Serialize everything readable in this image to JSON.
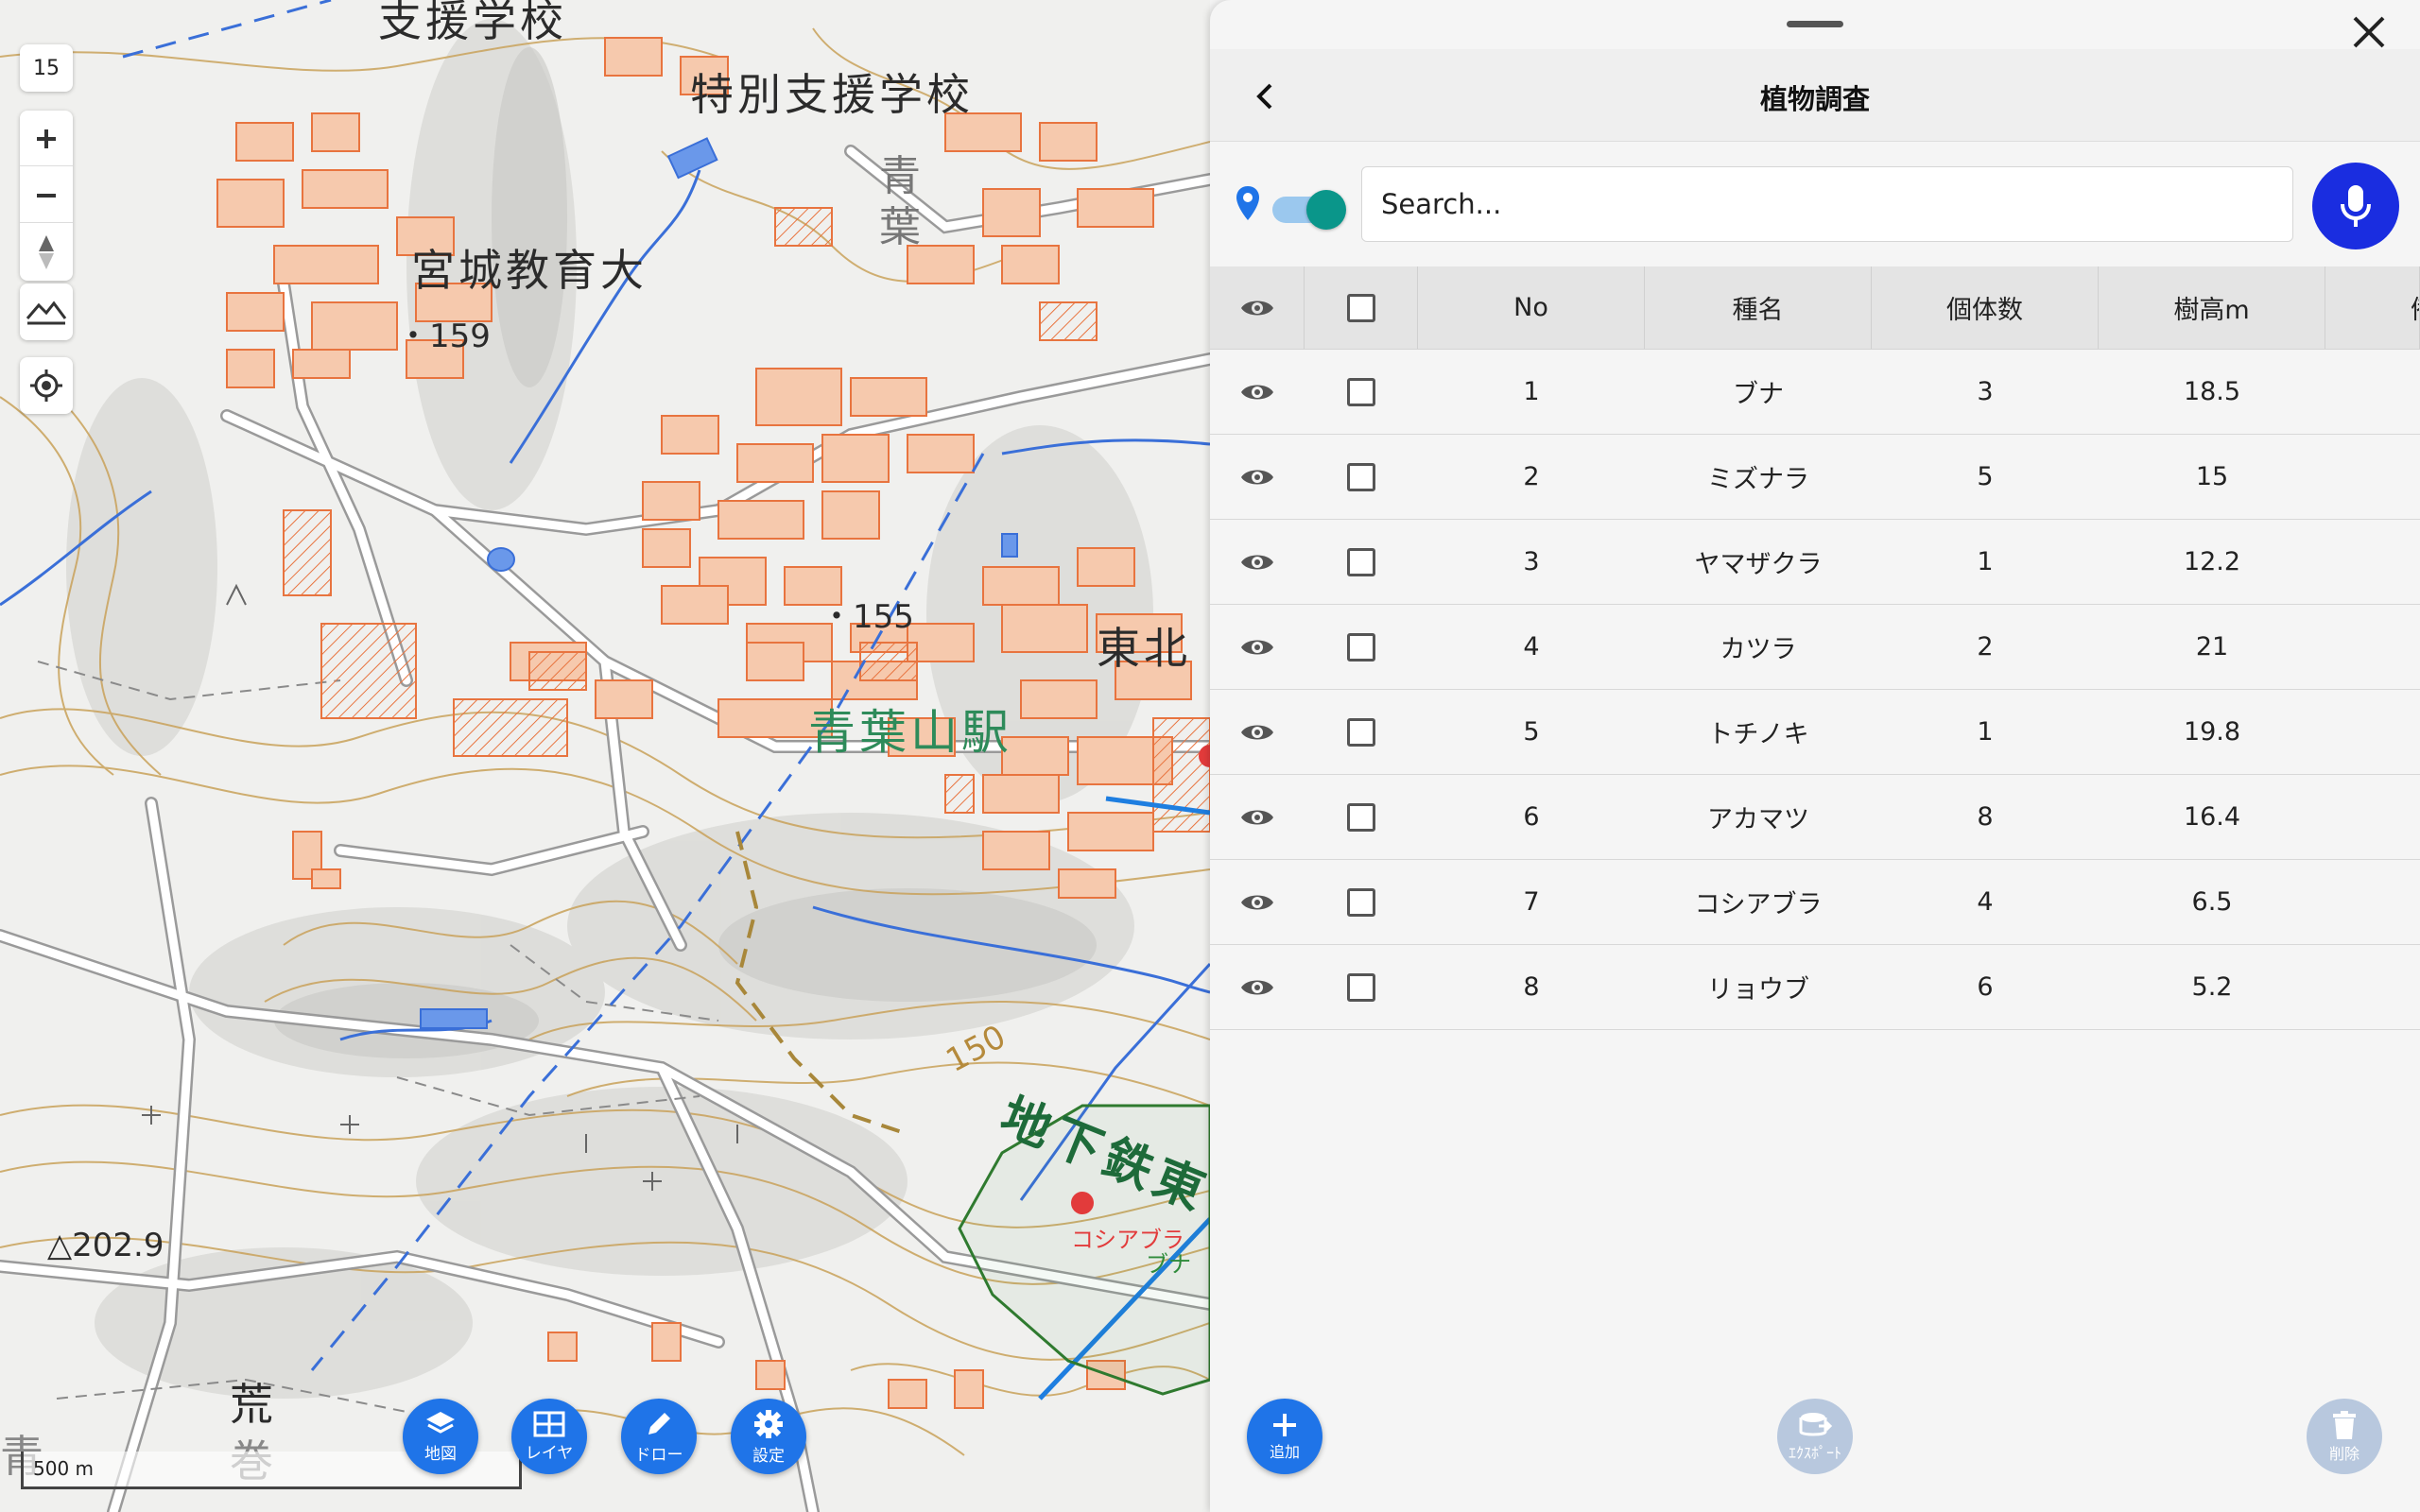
{
  "map": {
    "zoom_level": "15",
    "scale_label": "500 m",
    "labels": {
      "school_top": "支援学校",
      "special_school": "特別支援学校",
      "university": "宮城教育大",
      "elev_159": "・159",
      "aoba_vertical": "青\n葉",
      "elev_155": "・155",
      "tohoku": "東北",
      "station": "青葉山駅",
      "contour_150": "150",
      "subway": "地下鉄東",
      "triangulation": "△202.9",
      "ara": "荒",
      "maki": "巻",
      "ao": "青",
      "feature_koshiabura": "コシアブラ",
      "feature_buna": "ブナ"
    },
    "buttons": {
      "basemap": "地図",
      "layer": "レイヤ",
      "draw": "ドロー",
      "settings": "設定"
    },
    "colors": {
      "building": "#f1a27a",
      "contour": "#c9a25a",
      "water": "#3a6fd8",
      "road": "#ffffff",
      "polygon": "#2f7a2f",
      "point": "#e23b3b"
    }
  },
  "panel": {
    "title": "植物調査",
    "search": {
      "placeholder": "Search...",
      "value": ""
    },
    "toggle_on": true,
    "table": {
      "columns": [
        "No",
        "種名",
        "個体数",
        "樹高m",
        "備"
      ],
      "rows": [
        {
          "no": "1",
          "species": "ブナ",
          "count": "3",
          "height": "18.5"
        },
        {
          "no": "2",
          "species": "ミズナラ",
          "count": "5",
          "height": "15"
        },
        {
          "no": "3",
          "species": "ヤマザクラ",
          "count": "1",
          "height": "12.2"
        },
        {
          "no": "4",
          "species": "カツラ",
          "count": "2",
          "height": "21"
        },
        {
          "no": "5",
          "species": "トチノキ",
          "count": "1",
          "height": "19.8"
        },
        {
          "no": "6",
          "species": "アカマツ",
          "count": "8",
          "height": "16.4"
        },
        {
          "no": "7",
          "species": "コシアブラ",
          "count": "4",
          "height": "6.5"
        },
        {
          "no": "8",
          "species": "リョウブ",
          "count": "6",
          "height": "5.2"
        }
      ]
    },
    "bottom": {
      "add": "追加",
      "export": "ｴｸｽﾎﾟｰﾄ",
      "delete": "削除"
    },
    "colors": {
      "accent": "#1f74e8",
      "mic": "#1a2de0",
      "toggle_thumb": "#0a968a",
      "disabled": "#b8c8de"
    }
  }
}
